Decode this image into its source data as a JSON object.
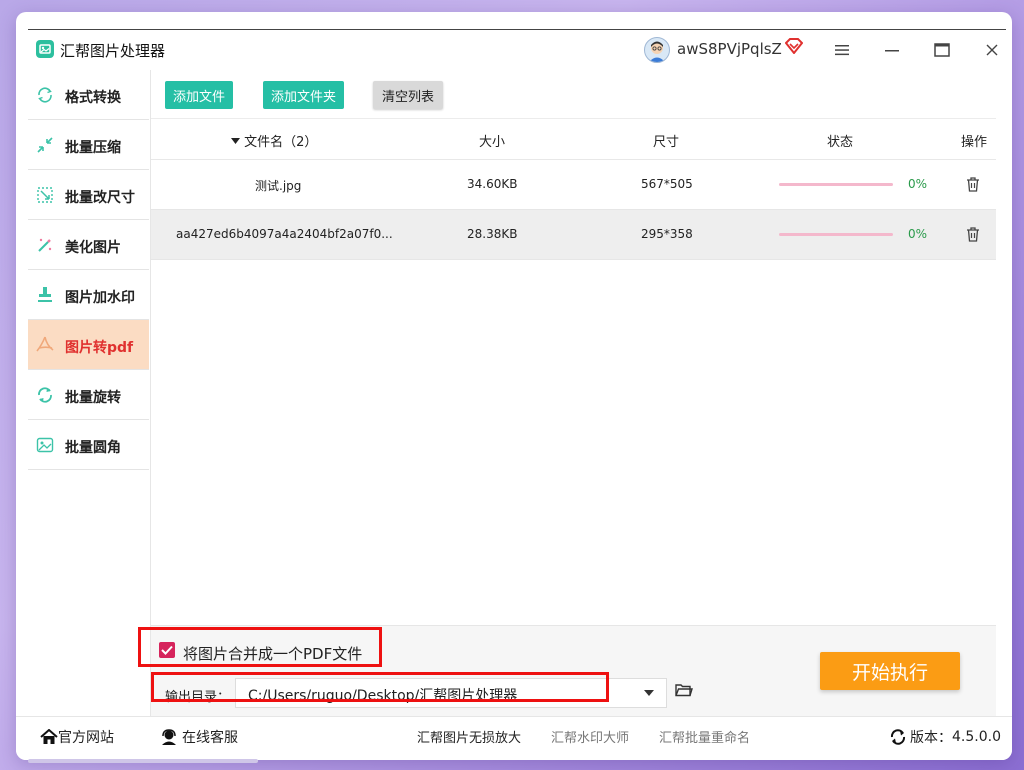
{
  "app": {
    "title": "汇帮图片处理器",
    "username": "awS8PVjPqlsZ"
  },
  "sidebar": {
    "items": [
      {
        "label": "格式转换",
        "icon": "format-convert-icon"
      },
      {
        "label": "批量压缩",
        "icon": "compress-icon"
      },
      {
        "label": "批量改尺寸",
        "icon": "resize-icon"
      },
      {
        "label": "美化图片",
        "icon": "beautify-icon"
      },
      {
        "label": "图片加水印",
        "icon": "watermark-icon"
      },
      {
        "label": "图片转pdf",
        "icon": "pdf-icon",
        "active": true
      },
      {
        "label": "批量旋转",
        "icon": "rotate-icon"
      },
      {
        "label": "批量圆角",
        "icon": "round-corner-icon"
      }
    ]
  },
  "toolbar": {
    "add_file": "添加文件",
    "add_folder": "添加文件夹",
    "clear_list": "清空列表"
  },
  "table": {
    "headers": {
      "name": "文件名（2）",
      "size": "大小",
      "dimensions": "尺寸",
      "status": "状态",
      "actions": "操作"
    },
    "rows": [
      {
        "name": "测试.jpg",
        "size": "34.60KB",
        "dimensions": "567*505",
        "progress": "0%"
      },
      {
        "name": "aa427ed6b4097a4a2404bf2a07f0...",
        "size": "28.38KB",
        "dimensions": "295*358",
        "progress": "0%"
      }
    ]
  },
  "options": {
    "merge_label": "将图片合并成一个PDF文件",
    "merge_checked": true,
    "output_label": "输出目录：",
    "output_path": "C:/Users/ruguo/Desktop/汇帮图片处理器",
    "start_label": "开始执行"
  },
  "statusbar": {
    "website": "官方网站",
    "support": "在线客服",
    "link1": "汇帮图片无损放大",
    "link2": "汇帮水印大师",
    "link3": "汇帮批量重命名",
    "version_label": "版本：",
    "version": "4.5.0.0"
  },
  "colors": {
    "accent_green": "#25bfa5",
    "start_orange": "#fb9c14",
    "active_bg": "#fbdcc3",
    "active_text": "#e0312f",
    "checkbox": "#d6245c",
    "progress": "#f4b8cc",
    "percent": "#2a9a4b"
  }
}
